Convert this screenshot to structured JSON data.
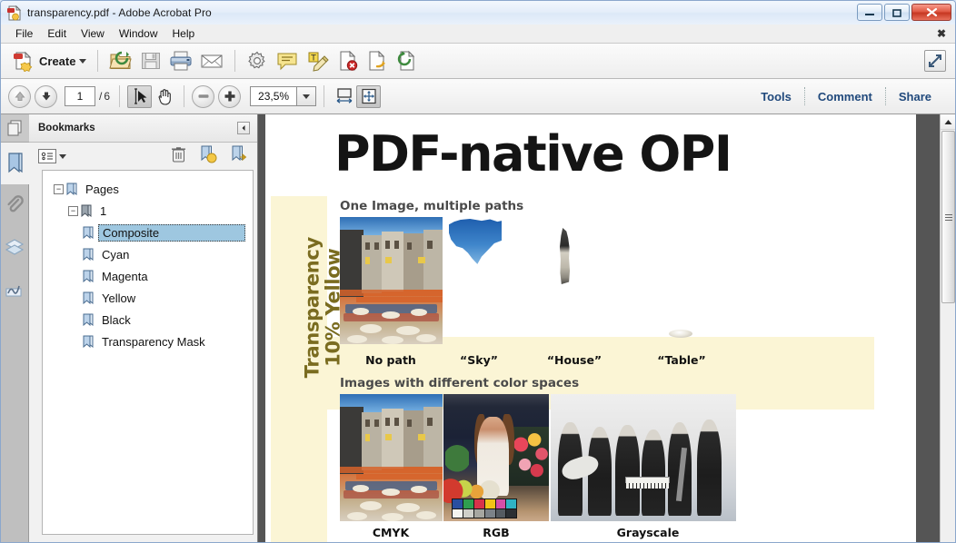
{
  "window": {
    "title": "transparency.pdf - Adobe Acrobat Pro",
    "app_icon": "pdf-document-icon",
    "controls": {
      "minimize": "─",
      "maximize": "□",
      "close": "✕"
    }
  },
  "menu": {
    "items": [
      "File",
      "Edit",
      "View",
      "Window",
      "Help"
    ],
    "close_doc": "✖"
  },
  "toolbar_main": {
    "create_label": "Create",
    "buttons": [
      {
        "name": "open-file-icon",
        "tip": "Open"
      },
      {
        "name": "save-icon",
        "tip": "Save"
      },
      {
        "name": "print-icon",
        "tip": "Print"
      },
      {
        "name": "email-icon",
        "tip": "Email"
      },
      {
        "name": "settings-gear-icon",
        "tip": "Settings"
      },
      {
        "name": "sticky-note-icon",
        "tip": "Add Sticky Note"
      },
      {
        "name": "highlight-text-icon",
        "tip": "Highlight Text"
      },
      {
        "name": "delete-page-icon",
        "tip": "Delete Pages"
      },
      {
        "name": "extract-page-icon",
        "tip": "Extract Pages"
      },
      {
        "name": "replace-page-icon",
        "tip": "Replace Pages"
      }
    ],
    "expand_label": "⤡"
  },
  "toolbar_nav": {
    "page_current": "1",
    "page_separator": "/",
    "page_total": "6",
    "zoom_value": "23,5%",
    "select_tool": "select-tool-icon",
    "hand_tool": "hand-tool-icon",
    "zoom_out": "−",
    "zoom_in": "+",
    "fit_width": "fit-width-icon",
    "fit_page": "fit-page-icon",
    "right_links": [
      "Tools",
      "Comment",
      "Share"
    ]
  },
  "sidebar_rail": [
    {
      "name": "page-thumbnails-icon",
      "active": false
    },
    {
      "name": "bookmarks-icon",
      "active": true
    },
    {
      "name": "attachments-paperclip-icon",
      "active": false
    },
    {
      "name": "layers-icon",
      "active": false
    },
    {
      "name": "signatures-icon",
      "active": false
    }
  ],
  "panel": {
    "title": "Bookmarks",
    "collapse_icon": "◂",
    "options_icon": "options-menu-icon",
    "tools": [
      {
        "name": "delete-bookmark-icon",
        "label": "Delete"
      },
      {
        "name": "new-bookmark-icon",
        "label": "New Bookmark"
      },
      {
        "name": "expand-bookmark-icon",
        "label": "Expand"
      }
    ],
    "bookmarks": [
      {
        "label": "Pages",
        "level": 0,
        "expander": "−",
        "selected": false
      },
      {
        "label": "1",
        "level": 1,
        "expander": "−",
        "selected": false
      },
      {
        "label": "Composite",
        "level": 2,
        "expander": "",
        "selected": true
      },
      {
        "label": "Cyan",
        "level": 2,
        "expander": "",
        "selected": false
      },
      {
        "label": "Magenta",
        "level": 2,
        "expander": "",
        "selected": false
      },
      {
        "label": "Yellow",
        "level": 2,
        "expander": "",
        "selected": false
      },
      {
        "label": "Black",
        "level": 2,
        "expander": "",
        "selected": false
      },
      {
        "label": "Transparency Mask",
        "level": 2,
        "expander": "",
        "selected": false
      }
    ]
  },
  "document": {
    "slide_title": "PDF-native OPI",
    "vertical_note_line1": "Transparency",
    "vertical_note_line2": "10% Yellow",
    "section1_label": "One Image, multiple paths",
    "section2_label": "Images with different color spaces",
    "path_captions": [
      "No path",
      "“Sky”",
      "“House”",
      "“Table”"
    ],
    "colorspace_captions": [
      "CMYK",
      "RGB",
      "Grayscale"
    ],
    "overlay_color": "#fbf5d5",
    "note_text_color": "#7a6c20",
    "section_label_color": "#4a4a4a"
  }
}
